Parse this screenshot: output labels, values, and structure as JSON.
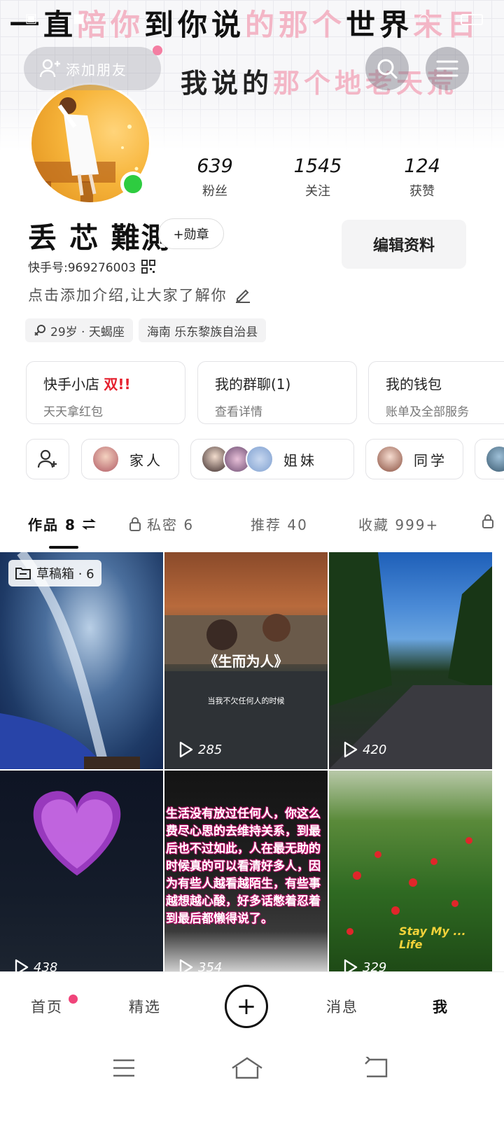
{
  "cover": {
    "line1_a": "一直",
    "line1_b": "陪你",
    "line1_c": "到你说",
    "line1_d": "的那个",
    "line1_e": "世界",
    "line1_f": "末日",
    "line2_a": "我说的",
    "line2_b": "那个",
    "line2_c": "地老天荒"
  },
  "header": {
    "add_friend_label": "添加朋友"
  },
  "profile": {
    "nickname": "丢 芯 難測",
    "medal_label": "+勋章",
    "kuaishou_id": "快手号:969276003",
    "intro_placeholder": "点击添加介绍,让大家了解你",
    "tags": [
      "29岁 · 天蝎座",
      "海南 乐东黎族自治县"
    ],
    "edit_label": "编辑资料"
  },
  "stats": [
    {
      "value": "639",
      "label": "粉丝"
    },
    {
      "value": "1545",
      "label": "关注"
    },
    {
      "value": "124",
      "label": "获赞"
    }
  ],
  "cards": [
    {
      "title": "快手小店",
      "badge": "双!!",
      "subtitle": "天天拿红包"
    },
    {
      "title": "我的群聊(1)",
      "badge": "",
      "subtitle": "查看详情"
    },
    {
      "title": "我的钱包",
      "badge": "",
      "subtitle": "账单及全部服务"
    }
  ],
  "groups": [
    {
      "name": "家人"
    },
    {
      "name": "姐妹"
    },
    {
      "name": "同学"
    }
  ],
  "tabs": [
    {
      "label": "作品 8",
      "active": true
    },
    {
      "label": "私密 6",
      "active": false
    },
    {
      "label": "推荐 40",
      "active": false
    },
    {
      "label": "收藏 999+",
      "active": false
    }
  ],
  "grid": {
    "draft_label": "草稿箱 · 6",
    "tiles": [
      {
        "plays": ""
      },
      {
        "plays": "285",
        "title": "《生而为人》",
        "subtitle": "当我不欠任何人的时候"
      },
      {
        "plays": "420"
      },
      {
        "plays": "438"
      },
      {
        "plays": "354",
        "quote": "生活没有放过任何人，你这么费尽心思的去维持关系，到最后也不过如此，人在最无助的时候真的可以看清好多人，因为有些人越看越陌生，有些事越想越心酸，好多话憋着忍着到最后都懒得说了。"
      },
      {
        "plays": "329",
        "overlay": "Stay My ... Life"
      }
    ]
  },
  "bottom_nav": [
    {
      "label": "首页",
      "has_dot": true
    },
    {
      "label": "精选",
      "has_dot": false
    },
    {
      "label": "+",
      "has_dot": false
    },
    {
      "label": "消息",
      "has_dot": false
    },
    {
      "label": "我",
      "has_dot": false
    }
  ],
  "colors": {
    "accent_red": "#e5202e",
    "online_green": "#2ecc40",
    "notify_pink": "#f0447a"
  }
}
